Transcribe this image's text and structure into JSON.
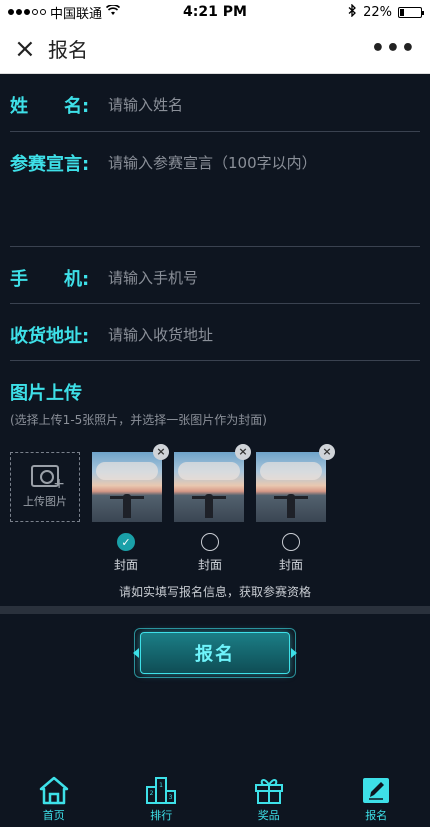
{
  "status": {
    "carrier": "中国联通",
    "time": "4:21 PM",
    "battery": "22%",
    "battery_level": 0.22
  },
  "nav": {
    "close_icon": "×",
    "title": "报名",
    "more_icon": "•••"
  },
  "form": {
    "name_label": "姓　　名:",
    "name_placeholder": "请输入姓名",
    "declaration_label": "参赛宣言:",
    "declaration_placeholder": "请输入参赛宣言（100字以内）",
    "phone_label": "手　　机:",
    "phone_placeholder": "请输入手机号",
    "address_label": "收货地址:",
    "address_placeholder": "请输入收货地址"
  },
  "upload": {
    "title": "图片上传",
    "subtitle": "(选择上传1-5张照片，并选择一张图片作为封面)",
    "button_label": "上传图片",
    "photos": [
      {
        "cover_label": "封面",
        "is_cover": true
      },
      {
        "cover_label": "封面",
        "is_cover": false
      },
      {
        "cover_label": "封面",
        "is_cover": false
      }
    ]
  },
  "notice": "请如实填写报名信息，获取参赛资格",
  "submit_label": "报名",
  "tabs": [
    {
      "label": "首页",
      "icon": "home-icon"
    },
    {
      "label": "排行",
      "icon": "ranking-icon"
    },
    {
      "label": "奖品",
      "icon": "gift-icon"
    },
    {
      "label": "报名",
      "icon": "edit-icon"
    }
  ],
  "colors": {
    "accent": "#3ee0e8",
    "background": "#0e1520"
  }
}
